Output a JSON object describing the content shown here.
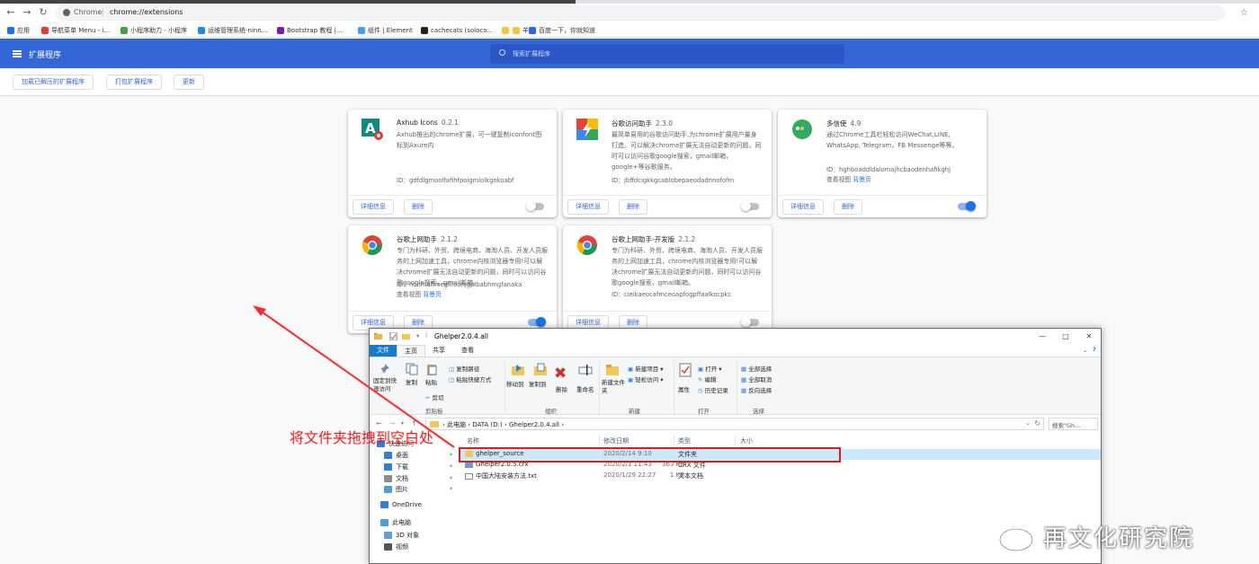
{
  "browser": {
    "omnibox_chrome": "Chrome",
    "omnibox_url": "chrome://extensions",
    "bookmarks": [
      {
        "label": "应用",
        "color": "#1a73e8"
      },
      {
        "label": "导航菜单 Menu - i...",
        "color": "#e53935"
      },
      {
        "label": "小程序助力 - 小程序",
        "color": "#43a047"
      },
      {
        "label": "运维管理系统-ninn...",
        "color": "#1e88e5"
      },
      {
        "label": "Bootstrap 教程 |...",
        "color": "#7b1fa2"
      },
      {
        "label": "组件 | Element",
        "color": "#409eff"
      },
      {
        "label": "cachecats (soloco...",
        "color": "#222222"
      },
      {
        "label": "",
        "color": "#f4c542"
      },
      {
        "label": "羊",
        "color": "#f4c542"
      },
      {
        "label": "百度一下，你就知道",
        "color": "#2962ff"
      }
    ]
  },
  "header": {
    "title": "扩展程序",
    "search_placeholder": "搜索扩展程序"
  },
  "toolbar": {
    "load_unpacked": "加载已解压的扩展程序",
    "pack": "打包扩展程序",
    "update": "更新"
  },
  "cards": [
    {
      "name": "Axhub Icons",
      "version": "0.2.1",
      "desc": "Axhub推出的chrome扩展，可一键复制iconfont图标到Axure内",
      "id": "ID：gdfdlgmoolfafihfpoigmlolkgnkoabf",
      "view": "",
      "view_link": "",
      "details": "详细信息",
      "remove": "删除",
      "enabled": false
    },
    {
      "name": "谷歌访问助手",
      "version": "2.3.0",
      "desc": "最简单易用的谷歌访问助手,为chrome扩展用户量身打造。可以解决chrome扩展无法自动更新的问题，同时可以访问谷歌google搜索，gmail邮箱，google+等谷歌服务。",
      "id": "ID：jbffdcigkkgcablobepaeodadnnofofm",
      "view": "",
      "view_link": "",
      "details": "详细信息",
      "remove": "删除",
      "enabled": false
    },
    {
      "name": "多信使",
      "version": "4.9",
      "desc": "通过Chrome工具栏轻松访问WeChat,LINE, WhatsApp, Telegram，FB Messenge等等。",
      "id": "ID：hghboaddldalomajhcbaodenhafikghj",
      "view": "查看视图",
      "view_link": "背景页",
      "details": "详细信息",
      "remove": "删除",
      "enabled": true
    },
    {
      "name": "谷歌上网助手",
      "version": "2.1.2",
      "desc": "专门为科研、外贸、跨境电商、海淘人员、开发人员服务的上网加速工具，chrome内核浏览器专用!可以解决chrome扩展无法自动更新的问题，同时可以访问谷歌google搜索，gmail邮箱。",
      "id": "ID：nonmafimegllfoonjgplbabhmgfanaka",
      "view": "查看视图",
      "view_link": "背景页",
      "details": "详细信息",
      "remove": "删除",
      "enabled": true
    },
    {
      "name": "谷歌上网助手-开发版",
      "version": "2.1.2",
      "desc": "专门为科研、外贸、跨境电商、海淘人员、开发人员服务的上网加速工具，chrome内核浏览器专用!可以解决chrome扩展无法自动更新的问题，同时可以访问谷歌google搜索，gmail邮箱。",
      "id": "ID：cieikaeocafmceoapfogpffaalkocpkc",
      "view": "",
      "view_link": "",
      "details": "详细信息",
      "remove": "删除",
      "enabled": false
    }
  ],
  "explorer": {
    "title": "Ghelper2.0.4.all",
    "tabs": [
      "文件",
      "主页",
      "共享",
      "查看"
    ],
    "ribbon": {
      "pin_quick": "固定到快速访问",
      "copy": "复制",
      "paste": "粘贴",
      "copy_path": "复制路径",
      "paste_shortcut": "粘贴快捷方式",
      "cut": "剪切",
      "clipboard": "剪贴板",
      "move_to": "移动到",
      "copy_to": "复制到",
      "delete": "删除",
      "rename": "重命名",
      "organize": "组织",
      "new_folder": "新建文件夹",
      "new_item": "新建项目",
      "easy_access": "轻松访问",
      "new_group": "新建",
      "properties": "属性",
      "open": "打开",
      "edit": "编辑",
      "history": "历史记录",
      "open_group": "打开",
      "select_all": "全部选择",
      "select_none": "全部取消",
      "invert": "反向选择",
      "select_group": "选择"
    },
    "path": [
      "此电脑",
      "DATA (D:)",
      "Ghelper2.0.4.all"
    ],
    "search_placeholder": "搜索\"Gh...",
    "columns": [
      "名称",
      "修改日期",
      "类型",
      "大小"
    ],
    "nav": [
      {
        "label": "快速访问",
        "color": "#2f7fd8"
      },
      {
        "label": "桌面",
        "color": "#2f7fd8"
      },
      {
        "label": "下载",
        "color": "#2f7fd8"
      },
      {
        "label": "文档",
        "color": "#8c8c8c"
      },
      {
        "label": "图片",
        "color": "#4a9fd8"
      },
      {
        "label": "OneDrive",
        "color": "#2f7fd8"
      },
      {
        "label": "此电脑",
        "color": "#4a9fd8"
      },
      {
        "label": "3D 对象",
        "color": "#5aa0d8"
      },
      {
        "label": "视频",
        "color": "#555555"
      }
    ],
    "files": [
      {
        "name": "ghelper_source",
        "date": "2020/2/14 9:10",
        "type": "文件夹",
        "size": "",
        "kind": "folder"
      },
      {
        "name": "Ghelper2.0.5.crx",
        "date": "2020/2/1 11:43",
        "type": "CRX 文件",
        "size": "363 KB",
        "kind": "crx"
      },
      {
        "name": "中国大陆安装方法.txt",
        "date": "2020/1/29 22:27",
        "type": "文本文档",
        "size": "1 KB",
        "kind": "txt"
      }
    ]
  },
  "annotation": "将文件夹拖拽到空白处",
  "watermark": "再文化研究院"
}
